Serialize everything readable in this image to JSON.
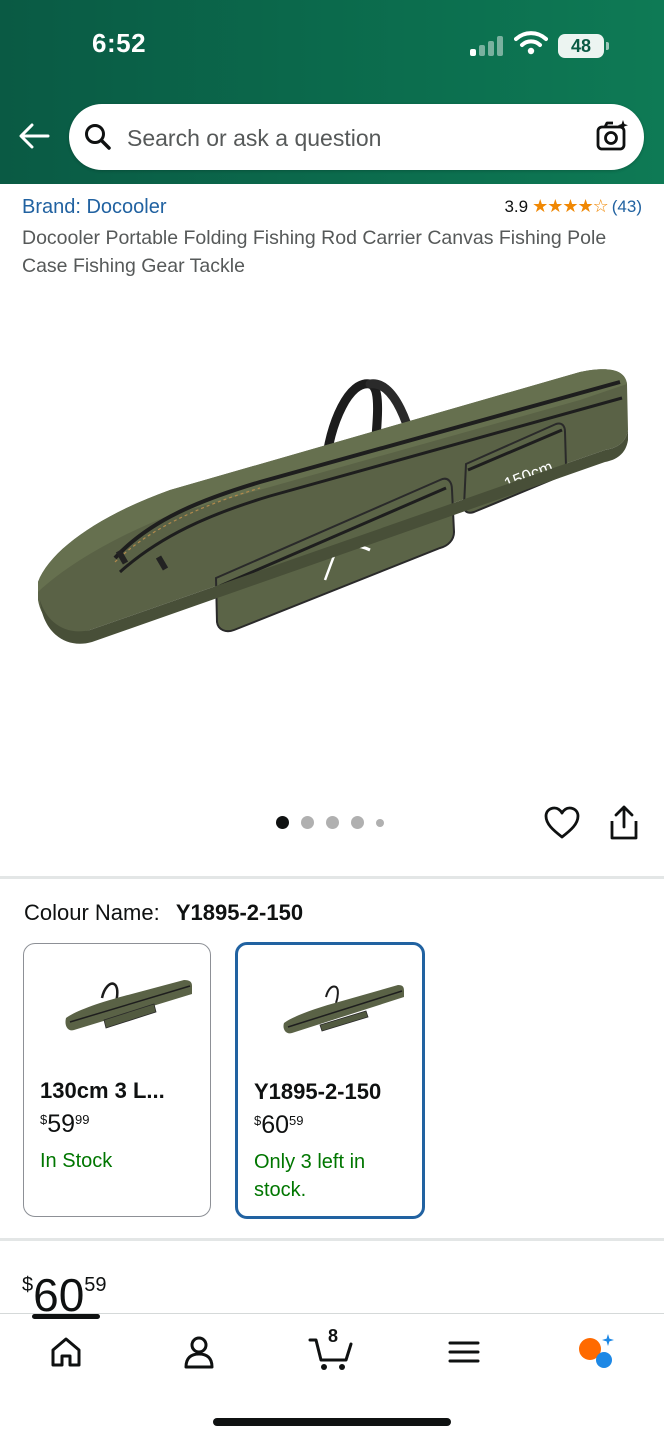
{
  "status_bar": {
    "time": "6:52",
    "battery": "48"
  },
  "search": {
    "placeholder": "Search or ask a question"
  },
  "product": {
    "brand": "Brand: Docooler",
    "rating_value": "3.9",
    "stars": "★★★★☆",
    "rating_count": "(43)",
    "title": "Docooler Portable Folding Fishing Rod Carrier Canvas Fishing Pole Case Fishing Gear Tackle",
    "image_label": "150cm"
  },
  "carousel": {
    "total_images": 5,
    "active_index": 0
  },
  "colour": {
    "label": "Colour Name:",
    "selected_value": "Y1895-2-150",
    "options": [
      {
        "name": "130cm 3 L...",
        "price_symbol": "$",
        "price_whole": "59",
        "price_fraction": "99",
        "stock": "In Stock",
        "selected": false
      },
      {
        "name": "Y1895-2-150",
        "price_symbol": "$",
        "price_whole": "60",
        "price_fraction": "59",
        "stock": "Only 3 left in stock.",
        "selected": true
      }
    ]
  },
  "price": {
    "symbol": "$",
    "whole": "60",
    "fraction": "59"
  },
  "bottom_nav": {
    "cart_count": "8",
    "items": [
      "home-icon",
      "account-icon",
      "cart-icon",
      "menu-icon",
      "assistant-icon"
    ]
  },
  "colors": {
    "header": "#0b6a4c",
    "link": "#2162a1",
    "stock_green": "#007600",
    "star": "#f08804",
    "bag_green": "#5a6246"
  }
}
